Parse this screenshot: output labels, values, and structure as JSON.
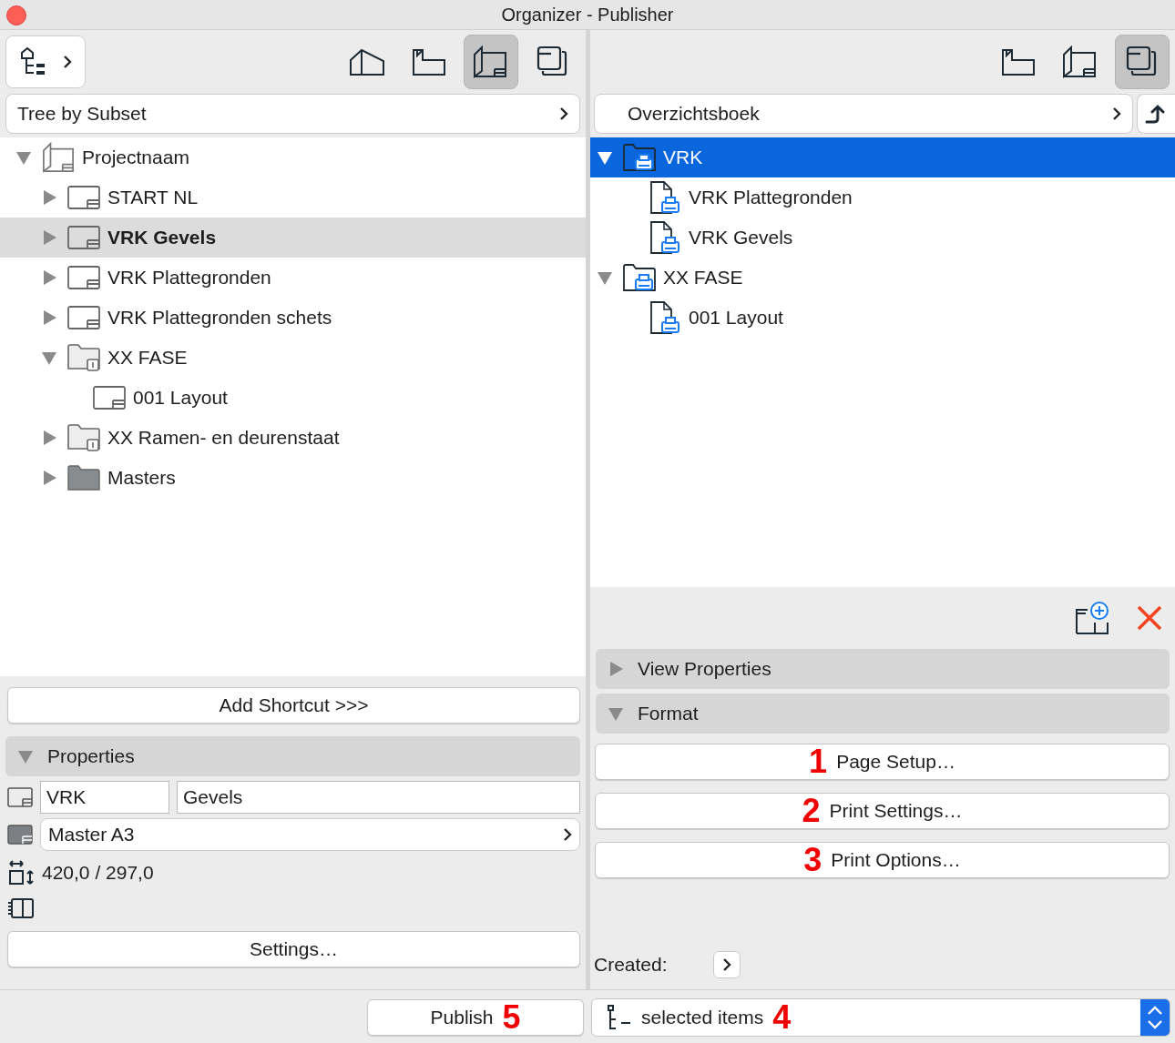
{
  "window": {
    "title": "Organizer - Publisher"
  },
  "left_panel": {
    "views": [
      {
        "kind": "model",
        "selected": false
      },
      {
        "kind": "sheet",
        "selected": false
      },
      {
        "kind": "layout",
        "selected": true
      },
      {
        "kind": "stack",
        "selected": false
      }
    ],
    "source": "Tree by Subset",
    "tree": [
      {
        "label": "Projectnaam",
        "kind": "book",
        "expanded": true,
        "selected": false,
        "children": [
          {
            "label": "START NL",
            "kind": "layout",
            "expanded": false,
            "selected": false
          },
          {
            "label": "VRK Gevels",
            "kind": "layout",
            "expanded": false,
            "selected": true
          },
          {
            "label": "VRK Plattegronden",
            "kind": "layout",
            "expanded": false,
            "selected": false
          },
          {
            "label": "VRK Plattegronden schets",
            "kind": "layout",
            "expanded": false,
            "selected": false
          },
          {
            "label": "XX FASE",
            "kind": "subset",
            "expanded": true,
            "selected": false,
            "children": [
              {
                "label": "001 Layout",
                "kind": "layout",
                "selected": false
              }
            ]
          },
          {
            "label": "XX Ramen- en deurenstaat",
            "kind": "subset",
            "expanded": false,
            "selected": false
          },
          {
            "label": "Masters",
            "kind": "masters",
            "expanded": false,
            "selected": false
          }
        ]
      }
    ],
    "add_shortcut": "Add Shortcut >>>",
    "properties": {
      "title": "Properties",
      "expanded": true,
      "id": "VRK",
      "name": "Gevels",
      "master": "Master A3",
      "size": "420,0 / 297,0",
      "settings": "Settings…"
    }
  },
  "right_panel": {
    "views": [
      {
        "kind": "sheet",
        "selected": false
      },
      {
        "kind": "layout",
        "selected": false
      },
      {
        "kind": "stack",
        "selected": true
      }
    ],
    "set": "Overzichtsboek",
    "tree": [
      {
        "label": "VRK",
        "kind": "folder",
        "expanded": true,
        "selected": true,
        "children": [
          {
            "label": "VRK Plattegronden",
            "kind": "item",
            "selected": false
          },
          {
            "label": "VRK Gevels",
            "kind": "item",
            "selected": false
          }
        ]
      },
      {
        "label": "XX FASE",
        "kind": "folder",
        "expanded": true,
        "selected": false,
        "children": [
          {
            "label": "001 Layout",
            "kind": "item",
            "selected": false
          }
        ]
      }
    ],
    "sections": [
      {
        "title": "View Properties",
        "expanded": false
      },
      {
        "title": "Format",
        "expanded": true
      }
    ],
    "format_buttons": [
      {
        "label": "Page Setup…",
        "marker": "1"
      },
      {
        "label": "Print Settings…",
        "marker": "2"
      },
      {
        "label": "Print Options…",
        "marker": "3"
      }
    ],
    "created_label": "Created:"
  },
  "bottom_bar": {
    "publish": {
      "label": "Publish",
      "marker": "5"
    },
    "scope": {
      "label": "selected items",
      "marker": "4"
    }
  }
}
